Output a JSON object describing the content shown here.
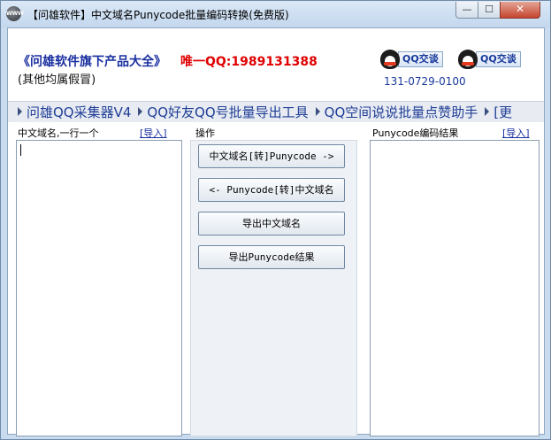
{
  "window": {
    "title": "【问雄软件】中文域名Punycode批量编码转换(免费版)",
    "icon_text": "WWW",
    "minimize_symbol": "—",
    "maximize_symbol": "☐",
    "close_symbol": "✕"
  },
  "header": {
    "brand_link": "《问雄软件旗下产品大全》",
    "qq_only": "唯一QQ:1989131388",
    "others_note": "(其他均属假冒)",
    "qq_button_1": "QQ交谈",
    "qq_button_2": "QQ交谈",
    "phone": "131-0729-0100"
  },
  "nav": {
    "items": [
      "问雄QQ采集器V4",
      "QQ好友QQ号批量导出工具",
      "QQ空间说说批量点赞助手",
      "[更"
    ]
  },
  "left_panel": {
    "label": "中文域名,一行一个",
    "import_link": "[导入]",
    "value": ""
  },
  "ops_panel": {
    "label": "操作",
    "buttons": [
      "中文域名[转]Punycode ->",
      "<- Punycode[转]中文域名",
      "导出中文域名",
      "导出Punycode结果"
    ]
  },
  "right_panel": {
    "label": "Punycode编码结果",
    "import_link": "[导入]",
    "value": ""
  },
  "colors": {
    "brand_blue": "#1a2fa0",
    "qq_red": "#e00000",
    "link_blue": "#1a3a9c"
  }
}
